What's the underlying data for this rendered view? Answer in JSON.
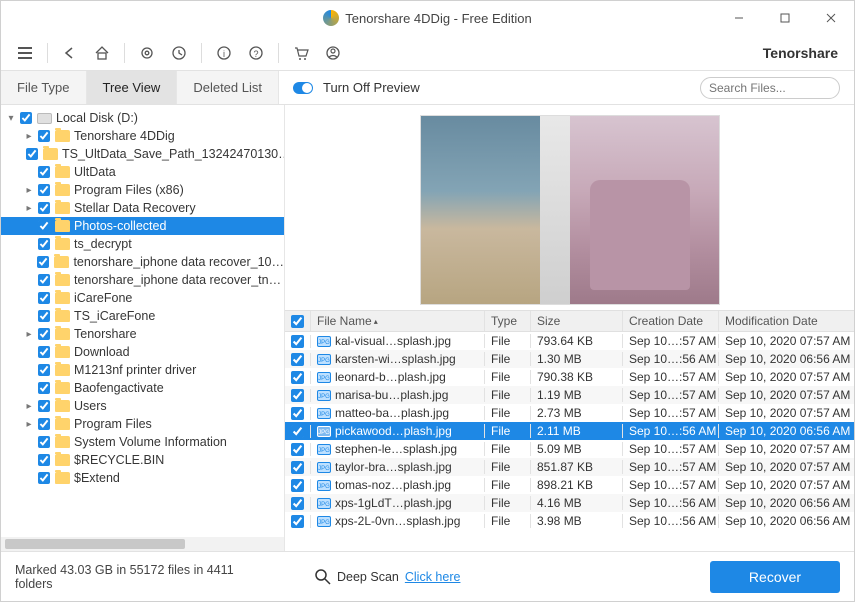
{
  "titlebar": {
    "title": "Tenorshare 4DDig - Free Edition"
  },
  "brand": "Tenorshare",
  "tabs": {
    "file_type": "File Type",
    "tree_view": "Tree View",
    "deleted_list": "Deleted List"
  },
  "preview_toggle_label": "Turn Off Preview",
  "search": {
    "placeholder": "Search Files..."
  },
  "tree": [
    {
      "depth": 0,
      "twisty": "▾",
      "icon": "disk",
      "label": "Local Disk (D:)"
    },
    {
      "depth": 1,
      "twisty": "▸",
      "icon": "folder",
      "label": "Tenorshare 4DDig"
    },
    {
      "depth": 1,
      "twisty": "",
      "icon": "folder",
      "label": "TS_UltData_Save_Path_13242470130…"
    },
    {
      "depth": 1,
      "twisty": "",
      "icon": "folder",
      "label": "UltData"
    },
    {
      "depth": 1,
      "twisty": "▸",
      "icon": "folder",
      "label": "Program Files (x86)"
    },
    {
      "depth": 1,
      "twisty": "▸",
      "icon": "folder",
      "label": "Stellar Data Recovery"
    },
    {
      "depth": 1,
      "twisty": "",
      "icon": "folder",
      "label": "Photos-collected",
      "selected": true
    },
    {
      "depth": 1,
      "twisty": "",
      "icon": "folder",
      "label": "ts_decrypt"
    },
    {
      "depth": 1,
      "twisty": "",
      "icon": "folder",
      "label": "tenorshare_iphone data recover_10…"
    },
    {
      "depth": 1,
      "twisty": "",
      "icon": "folder",
      "label": "tenorshare_iphone data recover_tn…"
    },
    {
      "depth": 1,
      "twisty": "",
      "icon": "folder",
      "label": "iCareFone"
    },
    {
      "depth": 1,
      "twisty": "",
      "icon": "folder",
      "label": "TS_iCareFone"
    },
    {
      "depth": 1,
      "twisty": "▸",
      "icon": "folder",
      "label": "Tenorshare"
    },
    {
      "depth": 1,
      "twisty": "",
      "icon": "folder",
      "label": "Download"
    },
    {
      "depth": 1,
      "twisty": "",
      "icon": "folder",
      "label": "M1213nf printer driver"
    },
    {
      "depth": 1,
      "twisty": "",
      "icon": "folder",
      "label": "Baofengactivate"
    },
    {
      "depth": 1,
      "twisty": "▸",
      "icon": "folder",
      "label": "Users"
    },
    {
      "depth": 1,
      "twisty": "▸",
      "icon": "folder",
      "label": "Program Files"
    },
    {
      "depth": 1,
      "twisty": "",
      "icon": "folder",
      "label": "System Volume Information"
    },
    {
      "depth": 1,
      "twisty": "",
      "icon": "folder",
      "label": "$RECYCLE.BIN"
    },
    {
      "depth": 1,
      "twisty": "",
      "icon": "folder",
      "label": "$Extend"
    }
  ],
  "grid": {
    "headers": {
      "name": "File Name",
      "type": "Type",
      "size": "Size",
      "cdate": "Creation Date",
      "mdate": "Modification Date"
    },
    "rows": [
      {
        "name": "kal-visual…splash.jpg",
        "type": "File",
        "size": "793.64 KB",
        "cdate": "Sep 10…:57 AM",
        "mdate": "Sep 10, 2020 07:57 AM"
      },
      {
        "name": "karsten-wi…splash.jpg",
        "type": "File",
        "size": "1.30 MB",
        "cdate": "Sep 10…:56 AM",
        "mdate": "Sep 10, 2020 06:56 AM"
      },
      {
        "name": "leonard-b…plash.jpg",
        "type": "File",
        "size": "790.38 KB",
        "cdate": "Sep 10…:57 AM",
        "mdate": "Sep 10, 2020 07:57 AM"
      },
      {
        "name": "marisa-bu…plash.jpg",
        "type": "File",
        "size": "1.19 MB",
        "cdate": "Sep 10…:57 AM",
        "mdate": "Sep 10, 2020 07:57 AM"
      },
      {
        "name": "matteo-ba…plash.jpg",
        "type": "File",
        "size": "2.73 MB",
        "cdate": "Sep 10…:57 AM",
        "mdate": "Sep 10, 2020 07:57 AM"
      },
      {
        "name": "pickawood…plash.jpg",
        "type": "File",
        "size": "2.11 MB",
        "cdate": "Sep 10…:56 AM",
        "mdate": "Sep 10, 2020 06:56 AM",
        "selected": true
      },
      {
        "name": "stephen-le…splash.jpg",
        "type": "File",
        "size": "5.09 MB",
        "cdate": "Sep 10…:57 AM",
        "mdate": "Sep 10, 2020 07:57 AM"
      },
      {
        "name": "taylor-bra…splash.jpg",
        "type": "File",
        "size": "851.87 KB",
        "cdate": "Sep 10…:57 AM",
        "mdate": "Sep 10, 2020 07:57 AM"
      },
      {
        "name": "tomas-noz…plash.jpg",
        "type": "File",
        "size": "898.21 KB",
        "cdate": "Sep 10…:57 AM",
        "mdate": "Sep 10, 2020 07:57 AM"
      },
      {
        "name": "xps-1gLdT…plash.jpg",
        "type": "File",
        "size": "4.16 MB",
        "cdate": "Sep 10…:56 AM",
        "mdate": "Sep 10, 2020 06:56 AM"
      },
      {
        "name": "xps-2L-0vn…splash.jpg",
        "type": "File",
        "size": "3.98 MB",
        "cdate": "Sep 10…:56 AM",
        "mdate": "Sep 10, 2020 06:56 AM"
      }
    ]
  },
  "footer": {
    "status": "Marked 43.03 GB in 55172 files in 4411 folders",
    "deepscan_label": "Deep Scan",
    "deepscan_link": "Click here",
    "recover": "Recover"
  }
}
